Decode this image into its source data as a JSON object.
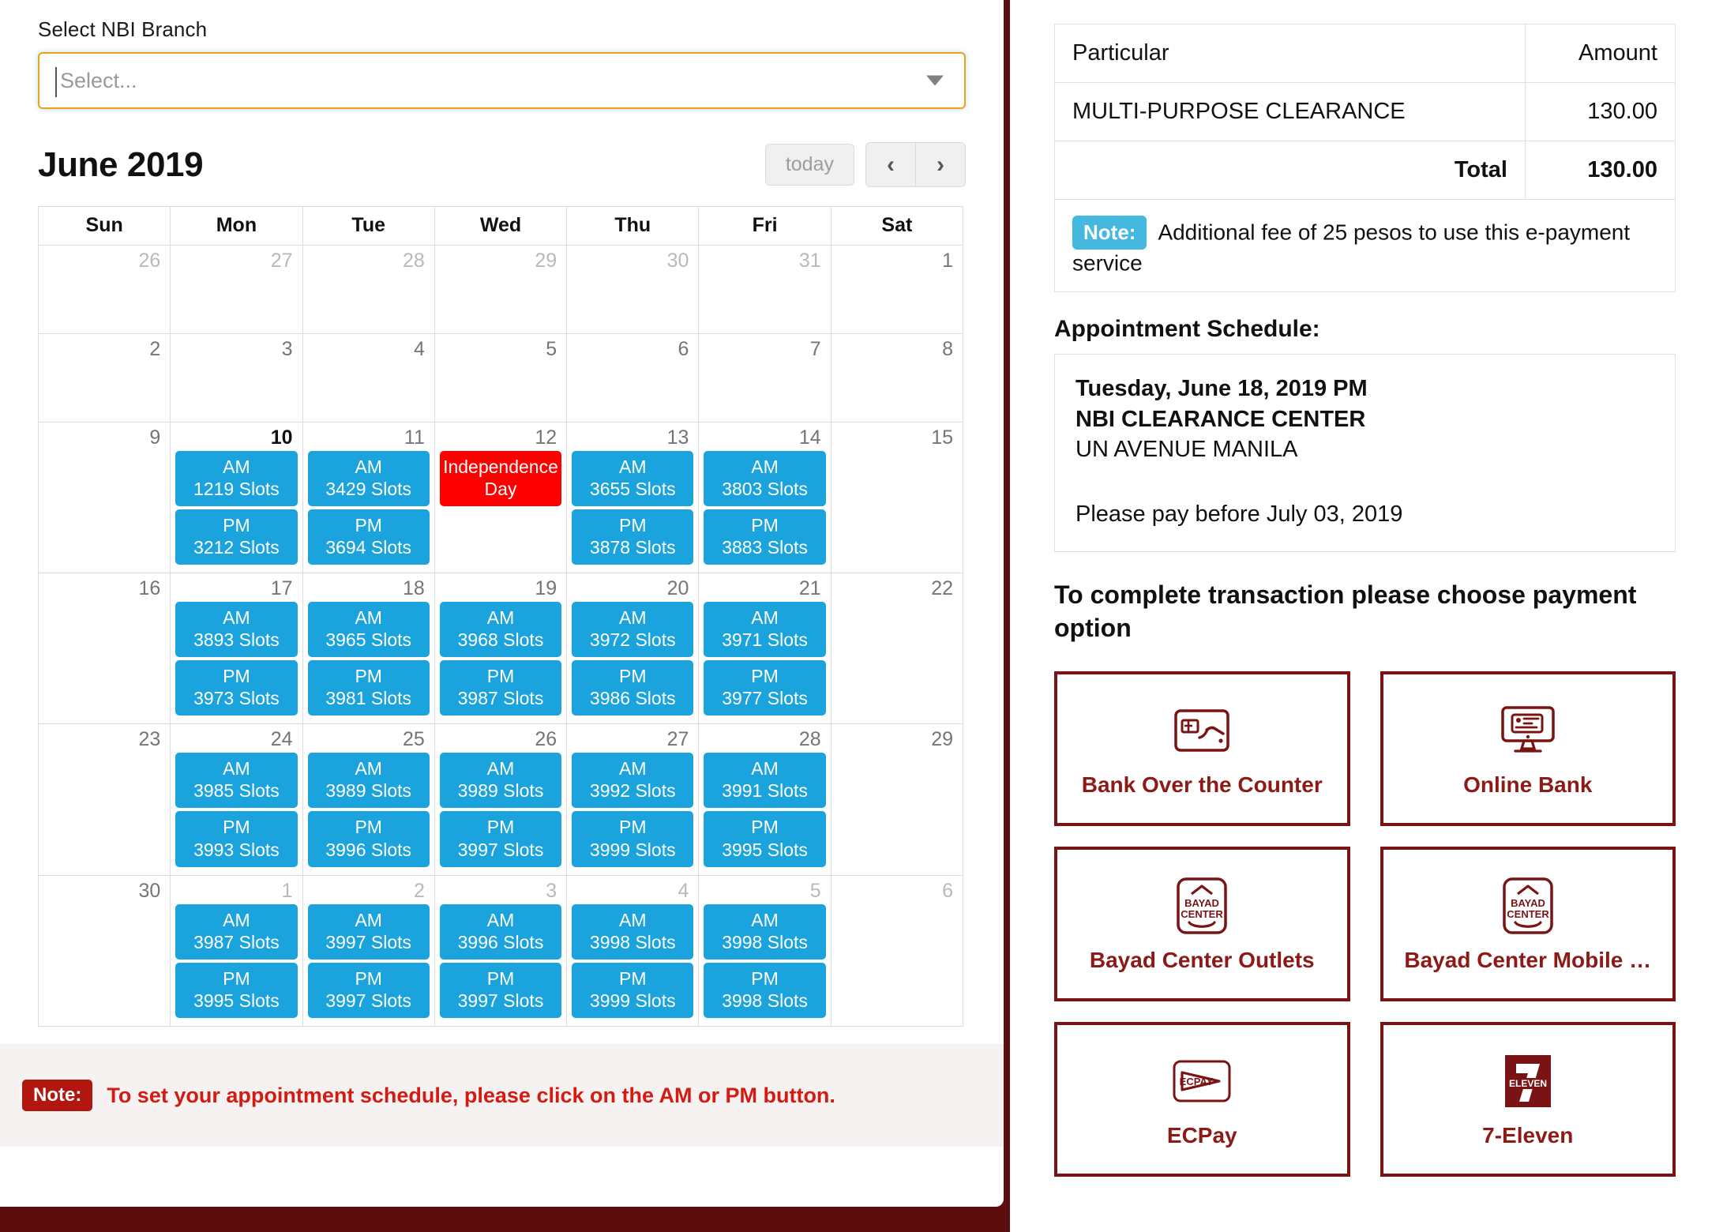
{
  "branch_selector": {
    "label": "Select NBI Branch",
    "placeholder": "Select...",
    "value": ""
  },
  "calendar": {
    "title": "June 2019",
    "today_button": "today",
    "prev_button": "‹",
    "next_button": "›",
    "weekdays": [
      "Sun",
      "Mon",
      "Tue",
      "Wed",
      "Thu",
      "Fri",
      "Sat"
    ],
    "weeks": [
      [
        {
          "day": "26",
          "other": true,
          "events": []
        },
        {
          "day": "27",
          "other": true,
          "events": []
        },
        {
          "day": "28",
          "other": true,
          "events": []
        },
        {
          "day": "29",
          "other": true,
          "events": []
        },
        {
          "day": "30",
          "other": true,
          "events": []
        },
        {
          "day": "31",
          "other": true,
          "events": []
        },
        {
          "day": "1",
          "other": false,
          "events": []
        }
      ],
      [
        {
          "day": "2",
          "other": false,
          "events": []
        },
        {
          "day": "3",
          "other": false,
          "events": []
        },
        {
          "day": "4",
          "other": false,
          "events": []
        },
        {
          "day": "5",
          "other": false,
          "events": []
        },
        {
          "day": "6",
          "other": false,
          "events": []
        },
        {
          "day": "7",
          "other": false,
          "events": []
        },
        {
          "day": "8",
          "other": false,
          "events": []
        }
      ],
      [
        {
          "day": "9",
          "other": false,
          "events": []
        },
        {
          "day": "10",
          "other": false,
          "today": true,
          "events": [
            {
              "title": "AM",
              "sub": "1219 Slots",
              "type": "slot"
            },
            {
              "title": "PM",
              "sub": "3212 Slots",
              "type": "slot"
            }
          ]
        },
        {
          "day": "11",
          "other": false,
          "events": [
            {
              "title": "AM",
              "sub": "3429 Slots",
              "type": "slot"
            },
            {
              "title": "PM",
              "sub": "3694 Slots",
              "type": "slot"
            }
          ]
        },
        {
          "day": "12",
          "other": false,
          "events": [
            {
              "title": "Independence",
              "sub": "Day",
              "type": "holiday"
            }
          ]
        },
        {
          "day": "13",
          "other": false,
          "events": [
            {
              "title": "AM",
              "sub": "3655 Slots",
              "type": "slot"
            },
            {
              "title": "PM",
              "sub": "3878 Slots",
              "type": "slot"
            }
          ]
        },
        {
          "day": "14",
          "other": false,
          "events": [
            {
              "title": "AM",
              "sub": "3803 Slots",
              "type": "slot"
            },
            {
              "title": "PM",
              "sub": "3883 Slots",
              "type": "slot"
            }
          ]
        },
        {
          "day": "15",
          "other": false,
          "events": []
        }
      ],
      [
        {
          "day": "16",
          "other": false,
          "events": []
        },
        {
          "day": "17",
          "other": false,
          "events": [
            {
              "title": "AM",
              "sub": "3893 Slots",
              "type": "slot"
            },
            {
              "title": "PM",
              "sub": "3973 Slots",
              "type": "slot"
            }
          ]
        },
        {
          "day": "18",
          "other": false,
          "events": [
            {
              "title": "AM",
              "sub": "3965 Slots",
              "type": "slot"
            },
            {
              "title": "PM",
              "sub": "3981 Slots",
              "type": "slot"
            }
          ]
        },
        {
          "day": "19",
          "other": false,
          "events": [
            {
              "title": "AM",
              "sub": "3968 Slots",
              "type": "slot"
            },
            {
              "title": "PM",
              "sub": "3987 Slots",
              "type": "slot"
            }
          ]
        },
        {
          "day": "20",
          "other": false,
          "events": [
            {
              "title": "AM",
              "sub": "3972 Slots",
              "type": "slot"
            },
            {
              "title": "PM",
              "sub": "3986 Slots",
              "type": "slot"
            }
          ]
        },
        {
          "day": "21",
          "other": false,
          "events": [
            {
              "title": "AM",
              "sub": "3971 Slots",
              "type": "slot"
            },
            {
              "title": "PM",
              "sub": "3977 Slots",
              "type": "slot"
            }
          ]
        },
        {
          "day": "22",
          "other": false,
          "events": []
        }
      ],
      [
        {
          "day": "23",
          "other": false,
          "events": []
        },
        {
          "day": "24",
          "other": false,
          "events": [
            {
              "title": "AM",
              "sub": "3985 Slots",
              "type": "slot"
            },
            {
              "title": "PM",
              "sub": "3993 Slots",
              "type": "slot"
            }
          ]
        },
        {
          "day": "25",
          "other": false,
          "events": [
            {
              "title": "AM",
              "sub": "3989 Slots",
              "type": "slot"
            },
            {
              "title": "PM",
              "sub": "3996 Slots",
              "type": "slot"
            }
          ]
        },
        {
          "day": "26",
          "other": false,
          "events": [
            {
              "title": "AM",
              "sub": "3989 Slots",
              "type": "slot"
            },
            {
              "title": "PM",
              "sub": "3997 Slots",
              "type": "slot"
            }
          ]
        },
        {
          "day": "27",
          "other": false,
          "events": [
            {
              "title": "AM",
              "sub": "3992 Slots",
              "type": "slot"
            },
            {
              "title": "PM",
              "sub": "3999 Slots",
              "type": "slot"
            }
          ]
        },
        {
          "day": "28",
          "other": false,
          "events": [
            {
              "title": "AM",
              "sub": "3991 Slots",
              "type": "slot"
            },
            {
              "title": "PM",
              "sub": "3995 Slots",
              "type": "slot"
            }
          ]
        },
        {
          "day": "29",
          "other": false,
          "events": []
        }
      ],
      [
        {
          "day": "30",
          "other": false,
          "events": []
        },
        {
          "day": "1",
          "other": true,
          "events": [
            {
              "title": "AM",
              "sub": "3987 Slots",
              "type": "slot"
            },
            {
              "title": "PM",
              "sub": "3995 Slots",
              "type": "slot"
            }
          ]
        },
        {
          "day": "2",
          "other": true,
          "events": [
            {
              "title": "AM",
              "sub": "3997 Slots",
              "type": "slot"
            },
            {
              "title": "PM",
              "sub": "3997 Slots",
              "type": "slot"
            }
          ]
        },
        {
          "day": "3",
          "other": true,
          "events": [
            {
              "title": "AM",
              "sub": "3996 Slots",
              "type": "slot"
            },
            {
              "title": "PM",
              "sub": "3997 Slots",
              "type": "slot"
            }
          ]
        },
        {
          "day": "4",
          "other": true,
          "events": [
            {
              "title": "AM",
              "sub": "3998 Slots",
              "type": "slot"
            },
            {
              "title": "PM",
              "sub": "3999 Slots",
              "type": "slot"
            }
          ]
        },
        {
          "day": "5",
          "other": true,
          "events": [
            {
              "title": "AM",
              "sub": "3998 Slots",
              "type": "slot"
            },
            {
              "title": "PM",
              "sub": "3998 Slots",
              "type": "slot"
            }
          ]
        },
        {
          "day": "6",
          "other": true,
          "events": []
        }
      ]
    ]
  },
  "calendar_note": {
    "badge": "Note:",
    "text": "To set your appointment schedule, please click on the AM or PM button."
  },
  "particulars": {
    "header_particular": "Particular",
    "header_amount": "Amount",
    "rows": [
      {
        "particular": "MULTI-PURPOSE CLEARANCE",
        "amount": "130.00"
      }
    ],
    "total_label": "Total",
    "total_amount": "130.00",
    "note_badge": "Note:",
    "note_text": "Additional fee of 25 pesos to use this e-payment service"
  },
  "appointment": {
    "heading": "Appointment Schedule:",
    "datetime": "Tuesday, June 18, 2019 PM",
    "center": "NBI CLEARANCE CENTER",
    "address": "UN AVENUE MANILA",
    "pay_before": "Please pay before July 03, 2019"
  },
  "payment": {
    "heading": "To complete transaction please choose payment option",
    "options": [
      {
        "label": "Bank Over the Counter",
        "icon": "hand-cash-icon"
      },
      {
        "label": "Online Bank",
        "icon": "desktop-card-icon"
      },
      {
        "label": "Bayad Center Outlets",
        "icon": "bayad-center-icon"
      },
      {
        "label": "Bayad Center Mobile …",
        "icon": "bayad-center-icon"
      },
      {
        "label": "ECPay",
        "icon": "ecpay-icon"
      },
      {
        "label": "7-Eleven",
        "icon": "seven-eleven-icon"
      }
    ]
  },
  "colors": {
    "brand_maroon": "#7a1414",
    "slot_blue": "#1aa3dd",
    "holiday_red": "#fe0000",
    "note_blue": "#45b8e0",
    "note_red": "#d21b12",
    "select_border": "#e8a317"
  }
}
